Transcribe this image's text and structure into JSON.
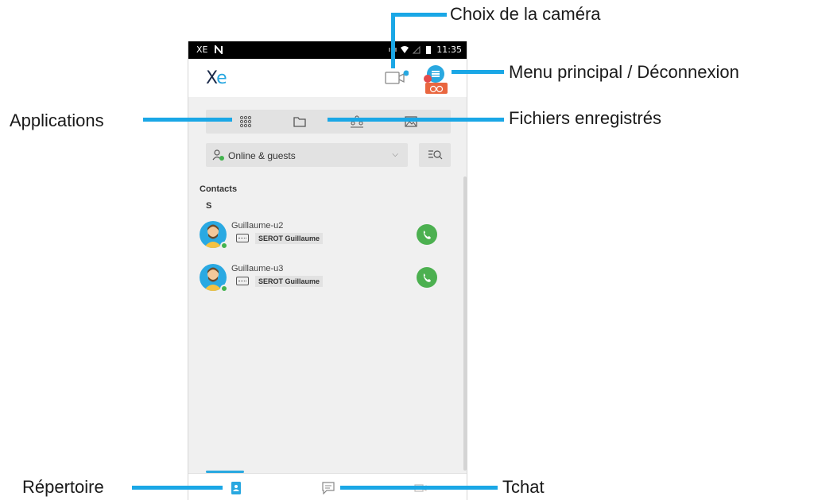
{
  "status_bar": {
    "carrier": "XE",
    "time": "11:35"
  },
  "app": {
    "logo_x": "X",
    "logo_e": "e"
  },
  "filter": {
    "label": "Online & guests"
  },
  "contacts": {
    "section_title": "Contacts",
    "letter": "S",
    "items": [
      {
        "name": "Guillaume-u2",
        "sub": "SEROT Guillaume"
      },
      {
        "name": "Guillaume-u3",
        "sub": "SEROT Guillaume"
      }
    ]
  },
  "annotations": {
    "camera": "Choix de la caméra",
    "menu": "Menu principal / Déconnexion",
    "applications": "Applications",
    "files": "Fichiers enregistrés",
    "directory": "Répertoire",
    "chat": "Tchat"
  },
  "colors": {
    "accent": "#29a8e0",
    "annotation_line": "#1aa7e6",
    "online": "#43b34e",
    "call": "#4cb050"
  }
}
